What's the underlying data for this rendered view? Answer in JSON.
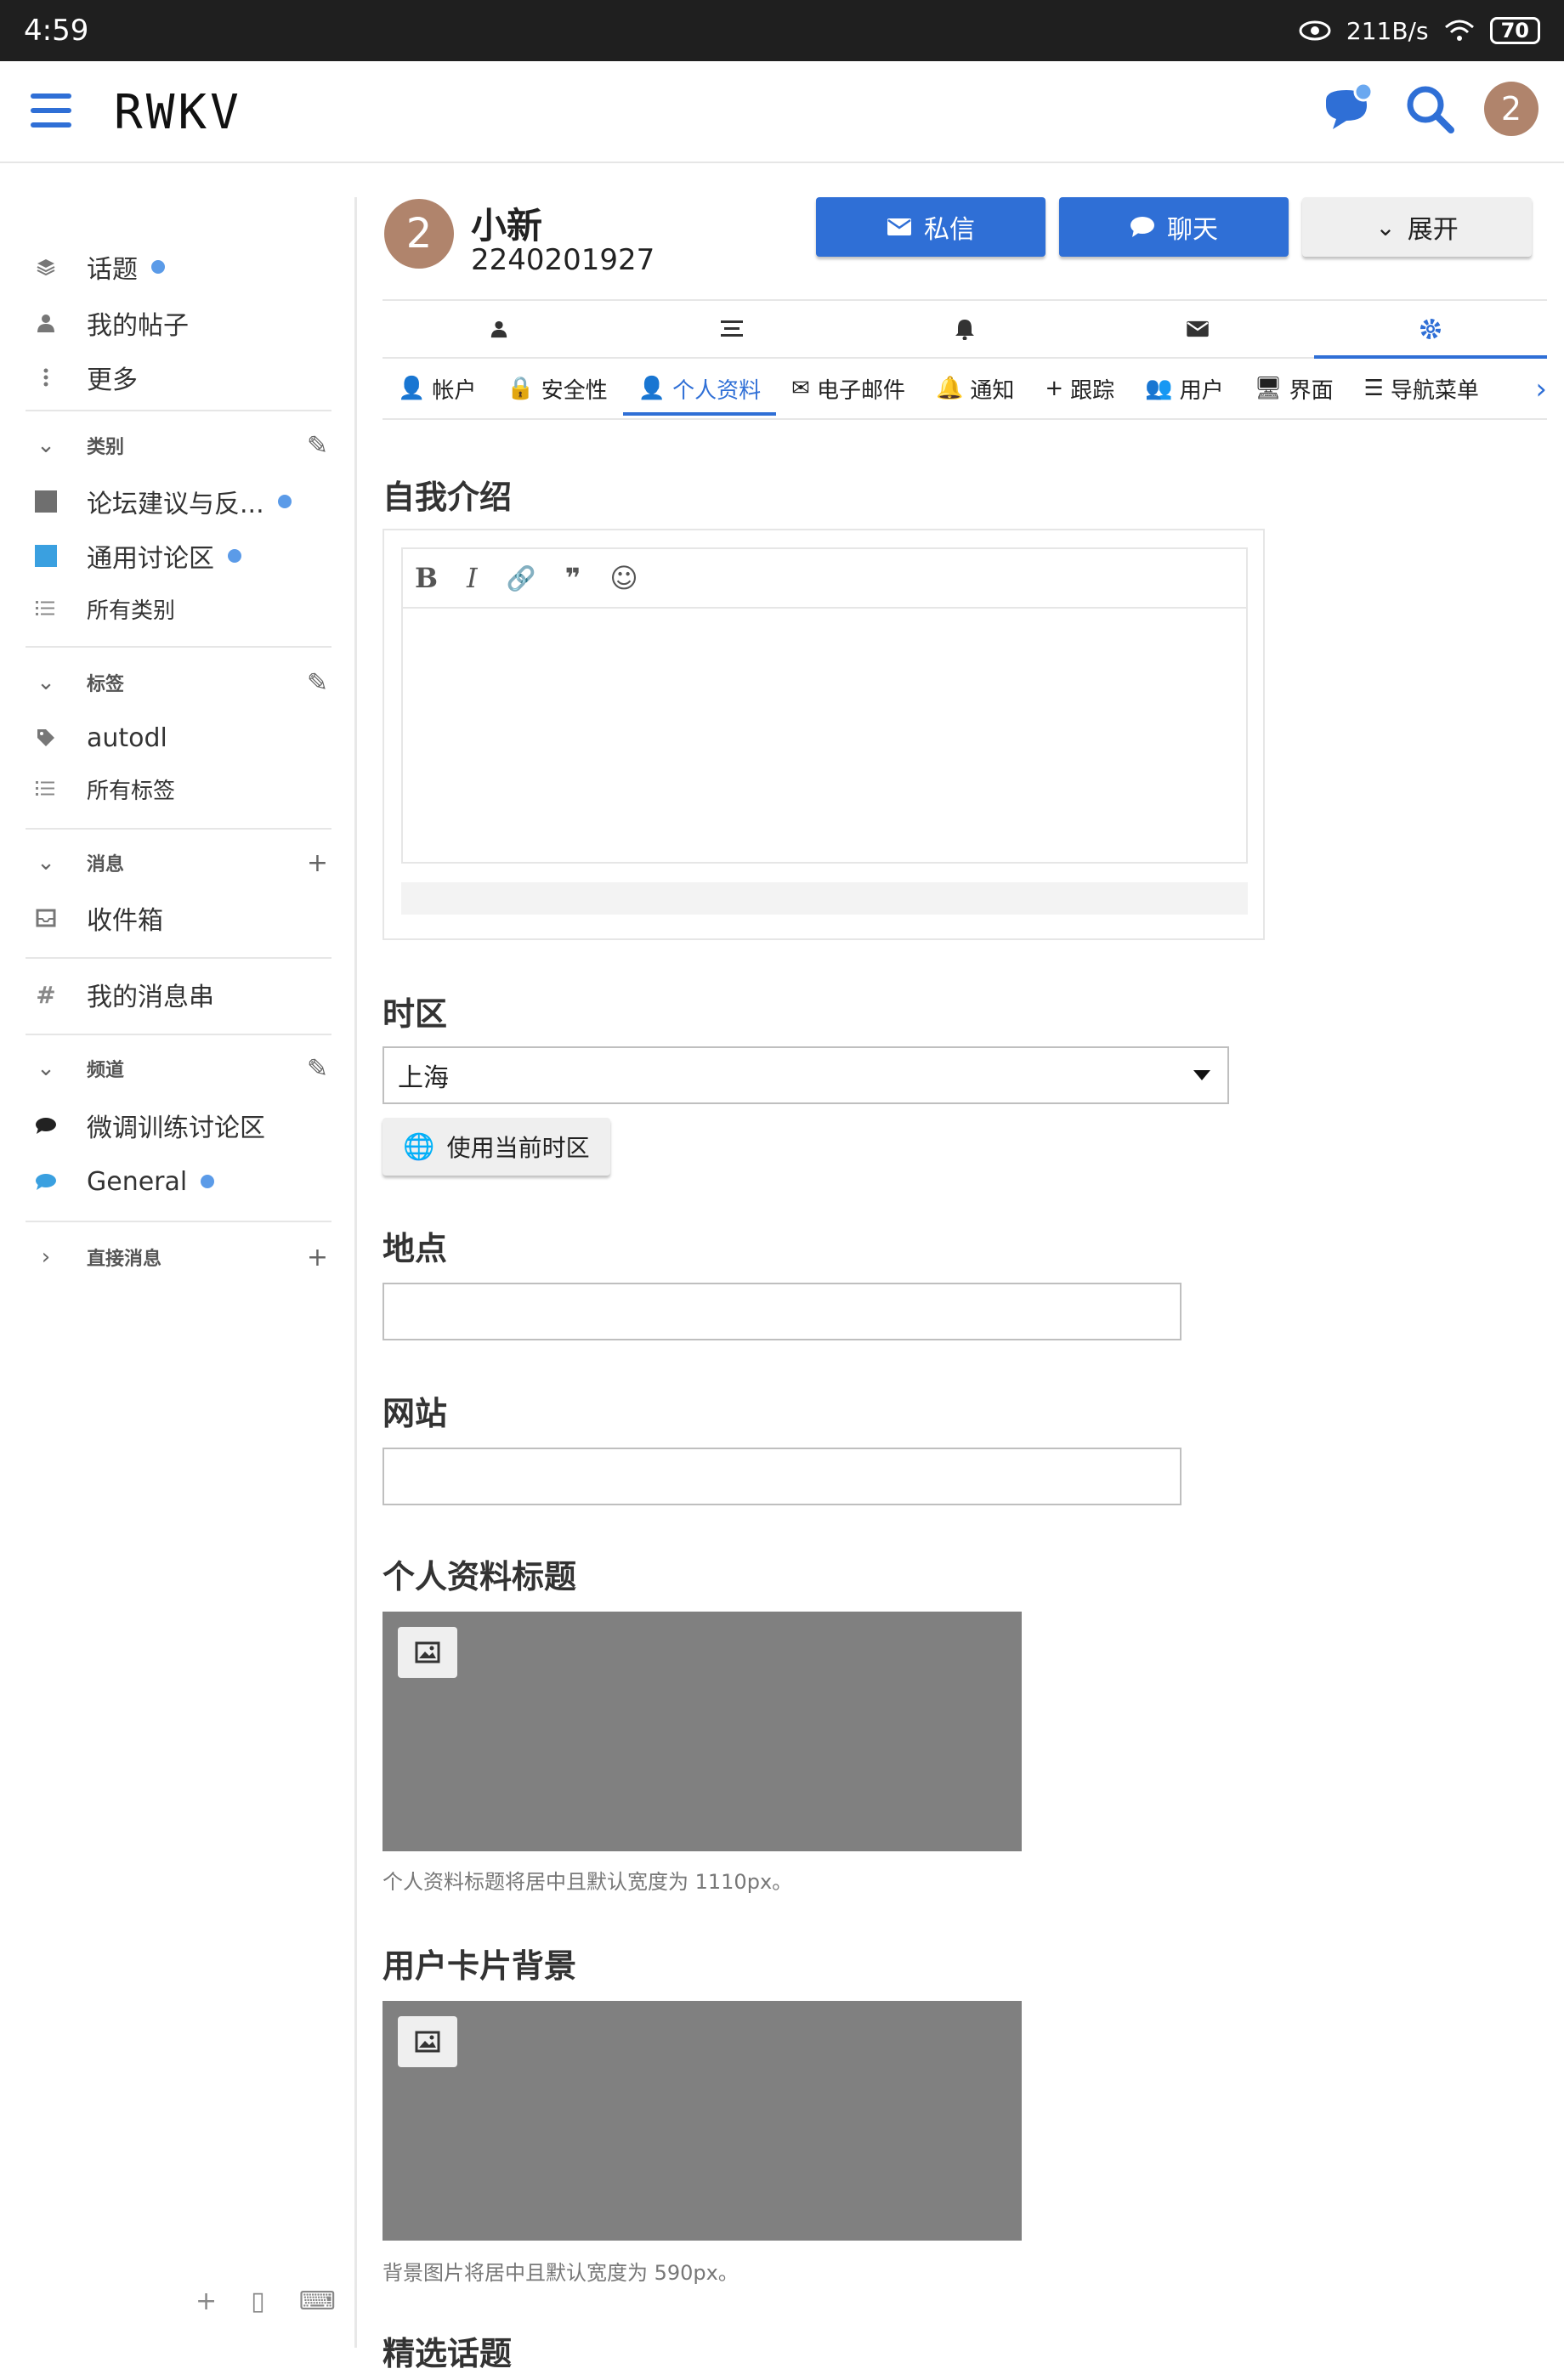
{
  "status": {
    "time": "4:59",
    "speed": "211B/s",
    "battery": "70"
  },
  "header": {
    "logo": "RWKV",
    "avatar_letter": "2"
  },
  "sidebar": {
    "items_top": [
      {
        "label": "话题",
        "dot": true
      },
      {
        "label": "我的帖子"
      },
      {
        "label": "更多"
      }
    ],
    "categories_head": "类别",
    "categories": [
      {
        "label": "论坛建议与反...",
        "color": "#6f6f6f",
        "dot": true
      },
      {
        "label": "通用讨论区",
        "color": "#3aa0e0",
        "dot": true
      },
      {
        "label": "所有类别"
      }
    ],
    "tags_head": "标签",
    "tags": [
      {
        "label": "autodl"
      },
      {
        "label": "所有标签"
      }
    ],
    "messages_head": "消息",
    "inbox": "收件箱",
    "my_threads": "我的消息串",
    "channels_head": "频道",
    "channels": [
      {
        "label": "微调训练讨论区"
      },
      {
        "label": "General",
        "dot": true
      }
    ],
    "direct_head": "直接消息"
  },
  "profile": {
    "avatar_letter": "2",
    "name": "小新",
    "id": "2240201927",
    "btn_message": "私信",
    "btn_chat": "聊天",
    "btn_expand": "展开"
  },
  "subtabs": [
    "帐户",
    "安全性",
    "个人资料",
    "电子邮件",
    "通知",
    "跟踪",
    "用户",
    "界面",
    "导航菜单"
  ],
  "form": {
    "bio_title": "自我介绍",
    "tz_title": "时区",
    "tz_value": "上海",
    "tz_button": "使用当前时区",
    "location_title": "地点",
    "website_title": "网站",
    "profile_header_title": "个人资料标题",
    "profile_header_hint": "个人资料标题将居中且默认宽度为 1110px。",
    "card_bg_title": "用户卡片背景",
    "card_bg_hint": "背景图片将居中且默认宽度为 590px。",
    "featured_title": "精选话题"
  },
  "colors": {
    "accent": "#2f6fd6",
    "image_placeholder": "#808080"
  }
}
